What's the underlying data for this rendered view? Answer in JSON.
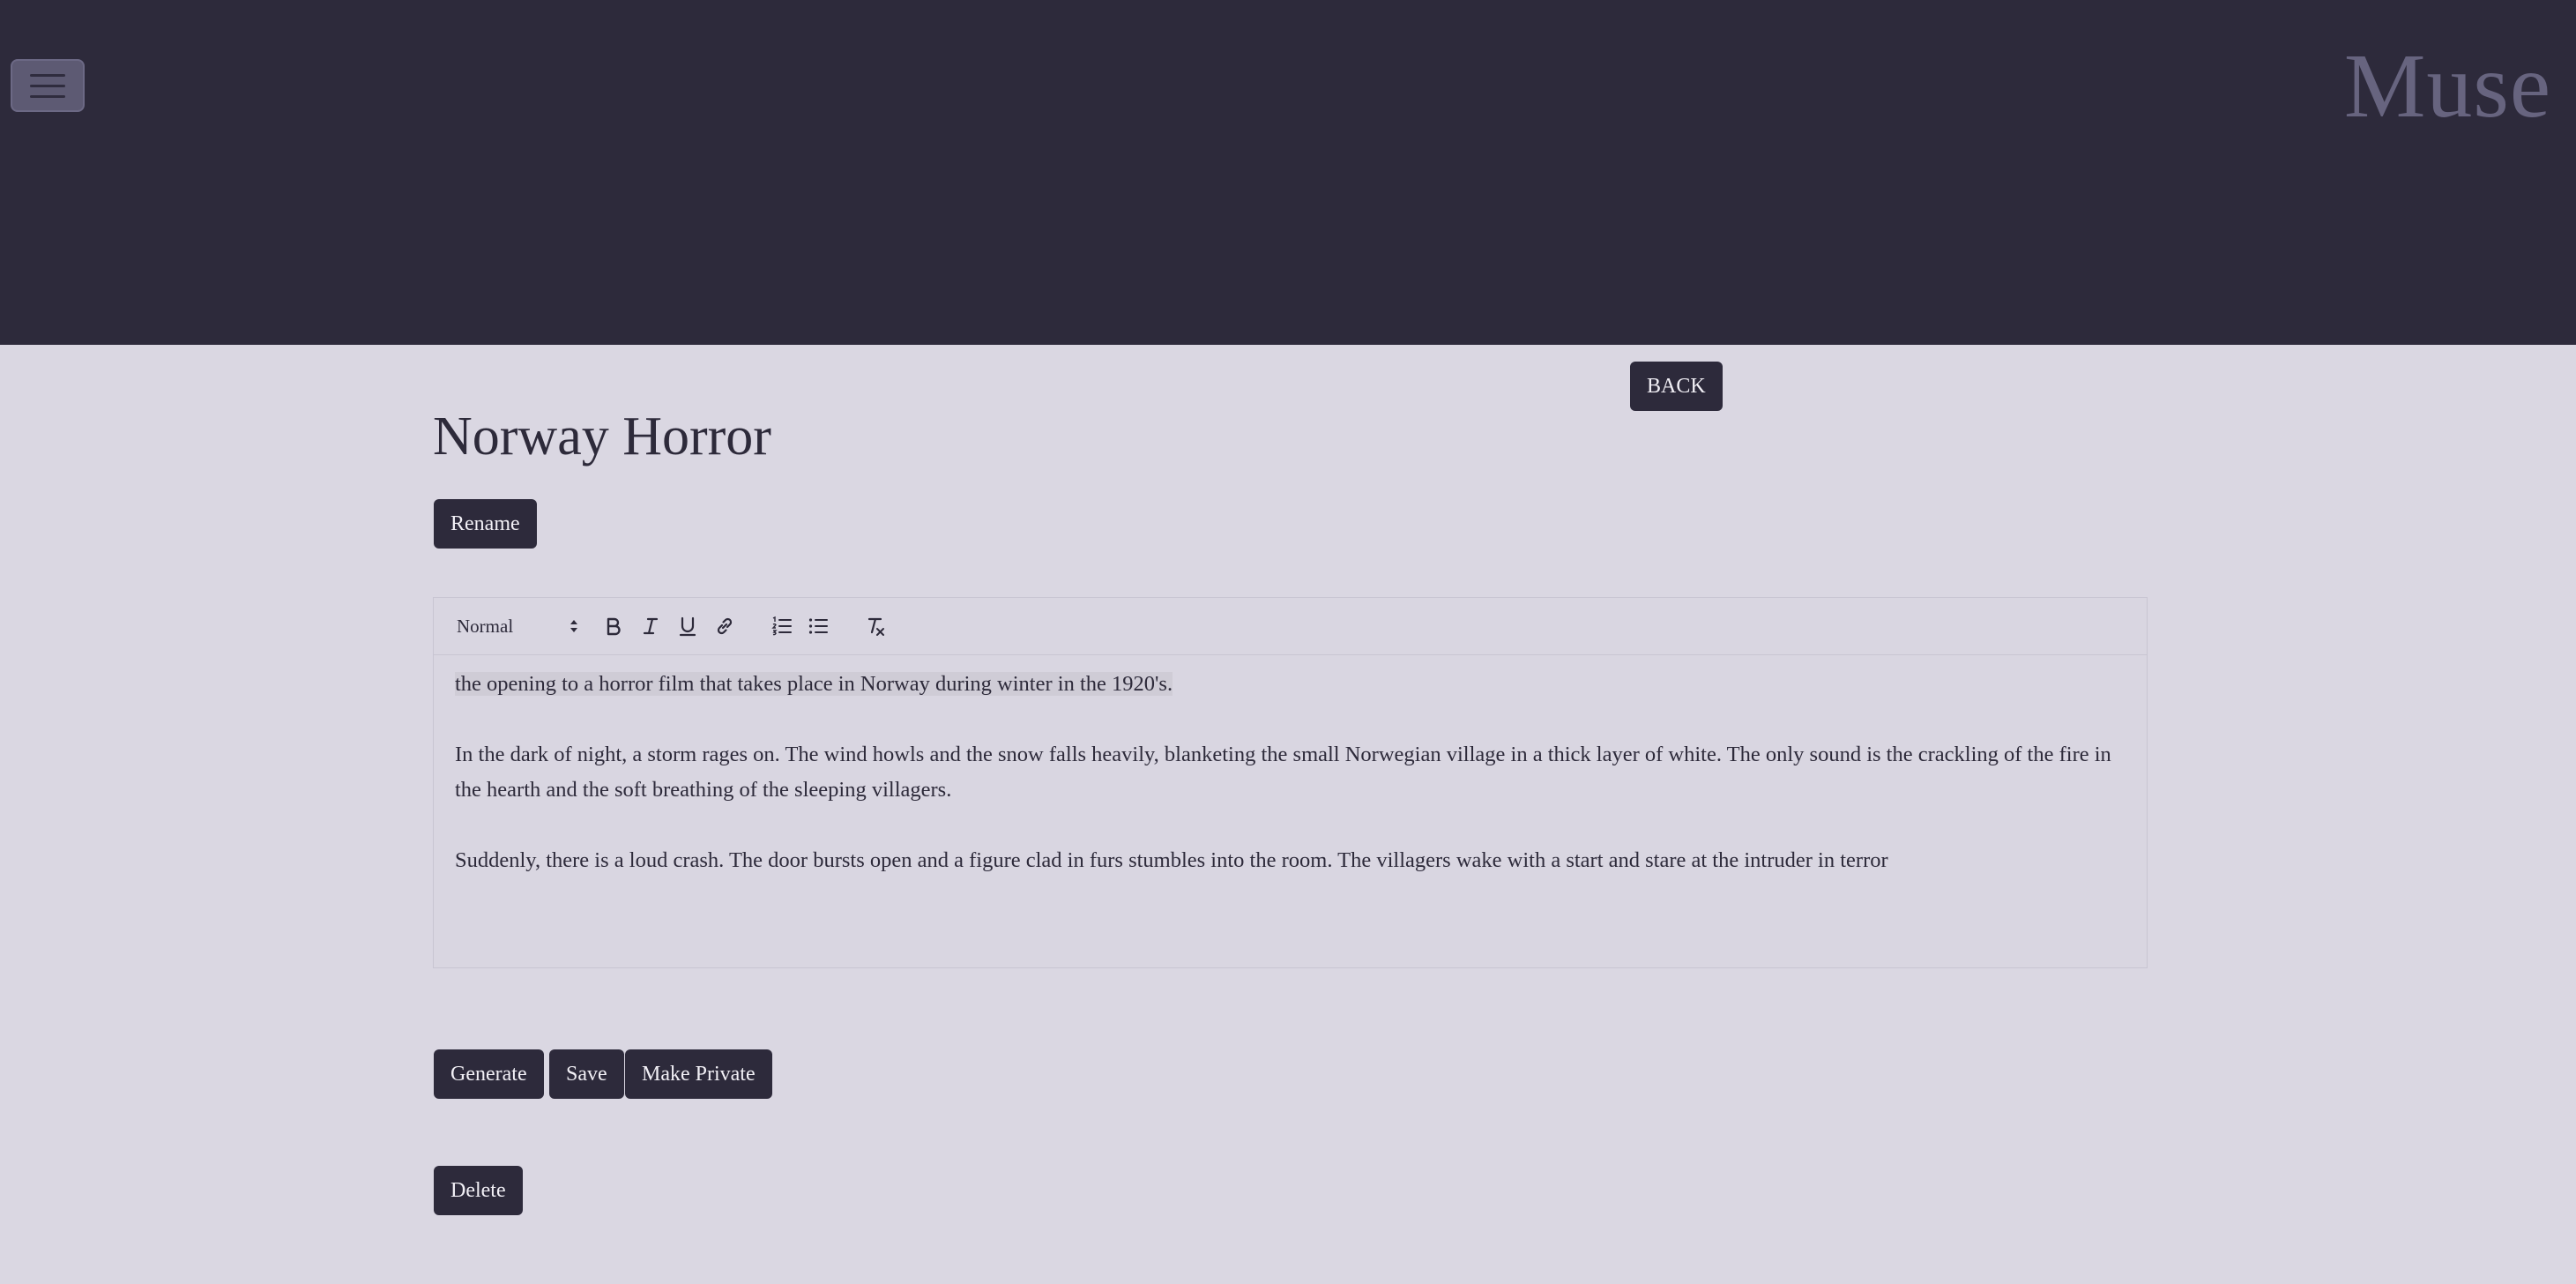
{
  "app": {
    "brand": "Muse"
  },
  "nav": {
    "back_label": "BACK"
  },
  "doc": {
    "title": "Norway Horror",
    "rename_label": "Rename"
  },
  "editor": {
    "format_select": "Normal",
    "toolbar_icons": [
      "bold-icon",
      "italic-icon",
      "underline-icon",
      "link-icon",
      "ordered-list-icon",
      "bullet-list-icon",
      "clear-format-icon"
    ],
    "prompt": "the opening to a horror film that takes place in Norway during winter in the 1920's.",
    "paragraph_1": "In the dark of night, a storm rages on. The wind howls and the snow falls heavily, blanketing the small Norwegian village in a thick layer of white. The only sound is the crackling of the fire in the hearth and the soft breathing of the sleeping villagers.",
    "paragraph_2": "Suddenly, there is a loud crash. The door bursts open and a figure clad in furs stumbles into the room. The villagers wake with a start and stare at the intruder in terror"
  },
  "actions": {
    "generate_label": "Generate",
    "save_label": "Save",
    "private_label": "Make Private",
    "delete_label": "Delete"
  },
  "colors": {
    "header_bg": "#2d2a3b",
    "page_bg": "#dad7e2",
    "button_bg": "#2d2a3b",
    "brand_text": "#67647f"
  }
}
